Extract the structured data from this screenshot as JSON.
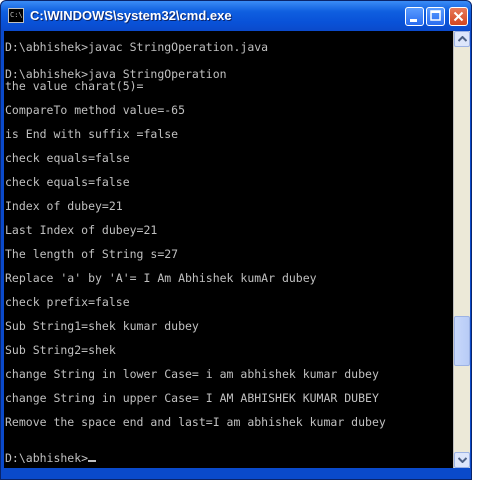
{
  "window": {
    "title": "C:\\WINDOWS\\system32\\cmd.exe",
    "icon_text": "C:\\"
  },
  "console": {
    "lines": [
      "D:\\abhishek>javac StringOperation.java",
      "D:\\abhishek>java StringOperation",
      "the value charat(5)=",
      "CompareTo method value=-65",
      "is End with suffix =false",
      "check equals=false",
      "check equals=false",
      "Index of dubey=21",
      "Last Index of dubey=21",
      "The length of String s=27",
      "Replace 'a' by 'A'= I Am Abhishek kumAr dubey",
      "check prefix=false",
      "Sub String1=shek kumar dubey",
      "Sub String2=shek",
      "change String in lower Case= i am abhishek kumar dubey",
      "change String in upper Case= I AM ABHISHEK KUMAR DUBEY",
      "Remove the space end and last=I am abhishek kumar dubey",
      "D:\\abhishek>"
    ]
  },
  "colors": {
    "titlebar": "#0a4acb",
    "console_bg": "#000000",
    "console_fg": "#c0c0c0"
  }
}
